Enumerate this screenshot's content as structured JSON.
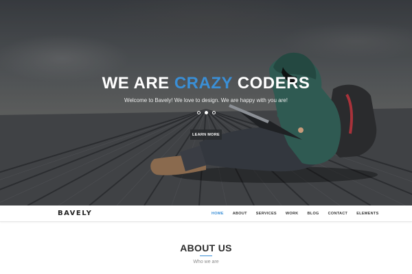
{
  "hero": {
    "title_part1": "WE ARE",
    "title_accent": "CRAZY",
    "title_part2": "CODERS",
    "subtitle": "Welcome to Bavely! We love to design. We are happy with you are!",
    "button_label": "LEARN MORE",
    "slides_total": 3,
    "active_slide": 2,
    "accent_color": "#3a8fd6"
  },
  "navbar": {
    "logo": "BAVELY",
    "items": [
      {
        "label": "HOME",
        "active": true
      },
      {
        "label": "ABOUT",
        "active": false
      },
      {
        "label": "SERVICES",
        "active": false
      },
      {
        "label": "WORK",
        "active": false
      },
      {
        "label": "BLOG",
        "active": false
      },
      {
        "label": "CONTACT",
        "active": false
      },
      {
        "label": "ELEMENTS",
        "active": false
      }
    ]
  },
  "about": {
    "title": "ABOUT US",
    "subtitle": "Who we are"
  }
}
